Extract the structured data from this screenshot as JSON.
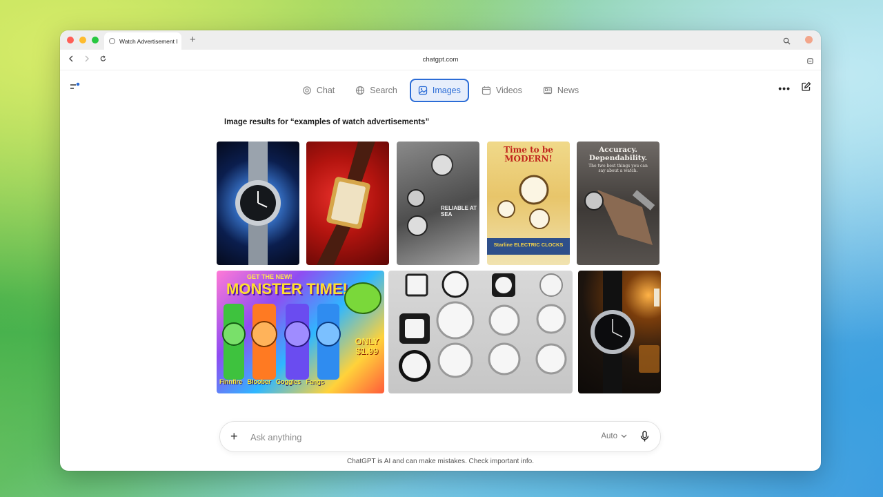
{
  "browser": {
    "tab_title": "Watch Advertisement I",
    "new_tab_symbol": "+",
    "url": "chatgpt.com"
  },
  "header": {
    "modes": [
      {
        "label": "Chat",
        "icon": "chat-bubble-icon",
        "active": false
      },
      {
        "label": "Search",
        "icon": "globe-icon",
        "active": false
      },
      {
        "label": "Images",
        "icon": "image-icon",
        "active": true
      },
      {
        "label": "Videos",
        "icon": "calendar-icon",
        "active": false
      },
      {
        "label": "News",
        "icon": "newspaper-icon",
        "active": false
      }
    ],
    "more_symbol": "•••"
  },
  "results": {
    "title": "Image results for “examples of watch advertisements”",
    "images": [
      {
        "caption": ""
      },
      {
        "caption": ""
      },
      {
        "caption": "RELIABLE AT SEA"
      },
      {
        "caption": "Time to be MODERN!",
        "caption2": "Starline ELECTRIC CLOCKS"
      },
      {
        "caption": "Accuracy. Dependability.",
        "caption2": "The two best things you can say about a watch."
      },
      {
        "caption": "GET THE NEW!",
        "caption2": "MONSTER TIME!",
        "caption3": "ONLY $1.99",
        "names": "Finnfire   Bloober   Goggles   Fangs"
      },
      {
        "caption": ""
      },
      {
        "caption": ""
      }
    ]
  },
  "composer": {
    "plus": "+",
    "placeholder": "Ask anything",
    "model": "Auto",
    "disclaimer": "ChatGPT is AI and can make mistakes. Check important info."
  },
  "colors": {
    "accent": "#2b6cd6",
    "active_bg": "#e7eefb"
  }
}
